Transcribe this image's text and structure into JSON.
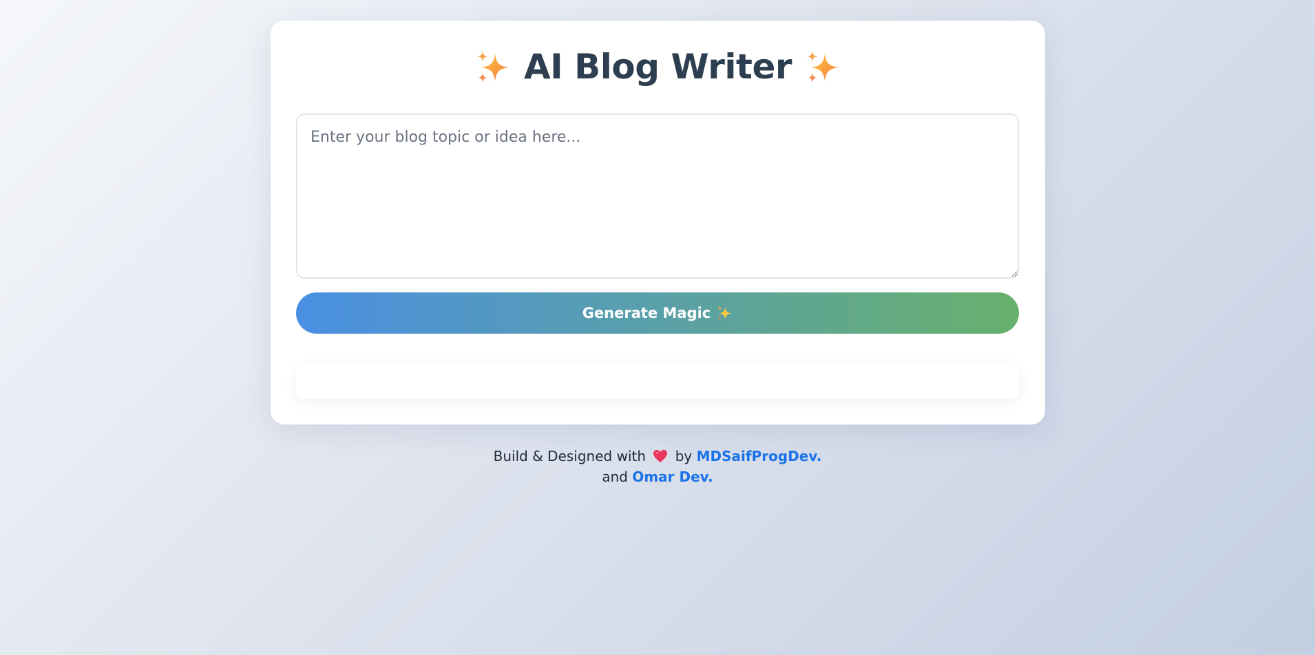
{
  "header": {
    "title": "AI Blog Writer",
    "left_icon": "sparkles-icon",
    "right_icon": "sparkles-icon"
  },
  "editor": {
    "placeholder": "Enter your blog topic or idea here...",
    "value": ""
  },
  "actions": {
    "generate_label": "Generate Magic",
    "generate_icon": "sparkles-icon"
  },
  "output": {
    "content": ""
  },
  "footer": {
    "prefix": "Build & Designed with",
    "heart_icon": "heart-icon",
    "by": "by",
    "author1": "MDSaifProgDev.",
    "and": "and",
    "author2": "Omar Dev."
  },
  "colors": {
    "background_start": "#f5f7fa",
    "background_end": "#c3cfe2",
    "title": "#2c3e50",
    "button_start": "#4a8fe2",
    "button_end": "#68b06c",
    "link": "#1a73e8",
    "heart": "#e8365d"
  }
}
